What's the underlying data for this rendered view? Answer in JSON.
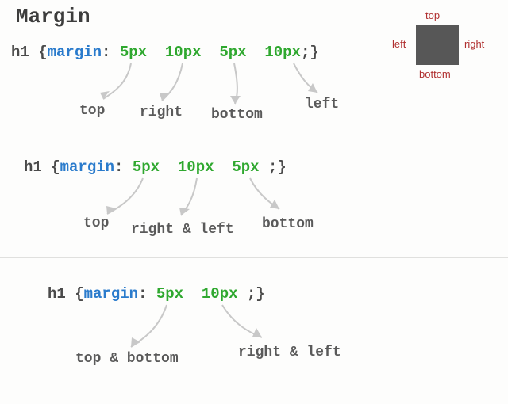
{
  "title": "Margin",
  "box": {
    "top": "top",
    "right": "right",
    "bottom": "bottom",
    "left": "left"
  },
  "ex1": {
    "selector": "h1 ",
    "open": "{",
    "prop": "margin",
    "colon": ": ",
    "v1": "5px",
    "sp1": "  ",
    "v2": "10px",
    "sp2": "  ",
    "v3": "5px",
    "sp3": "  ",
    "v4": "10px",
    "end": ";}",
    "a1": "top",
    "a2": "right",
    "a3": "bottom",
    "a4": "left"
  },
  "ex2": {
    "selector": "h1 ",
    "open": "{",
    "prop": "margin",
    "colon": ": ",
    "v1": "5px",
    "sp1": "  ",
    "v2": "10px",
    "sp2": "  ",
    "v3": "5px",
    "end": " ;}",
    "a1": "top",
    "a2": "right & left",
    "a3": "bottom"
  },
  "ex3": {
    "selector": "h1 ",
    "open": "{",
    "prop": "margin",
    "colon": ": ",
    "v1": "5px",
    "sp1": "  ",
    "v2": "10px",
    "end": " ;}",
    "a1": "top & bottom",
    "a2": "right & left"
  }
}
